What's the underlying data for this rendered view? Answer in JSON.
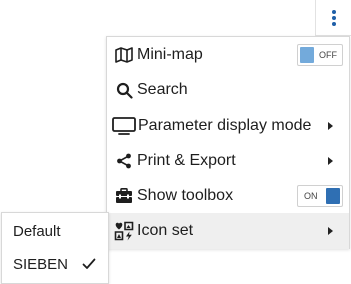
{
  "toolbar": {
    "more_icon": "kebab-vertical-icon",
    "accent_color": "#1f5fa8"
  },
  "menu": {
    "items": [
      {
        "label": "Mini-map",
        "icon": "map-icon",
        "toggle": {
          "state": "off",
          "label": "OFF"
        }
      },
      {
        "label": "Search",
        "icon": "search-icon"
      },
      {
        "label": "Parameter display mode",
        "icon": "monitor-icon",
        "has_submenu": true
      },
      {
        "label": "Print & Export",
        "icon": "share-icon",
        "has_submenu": true
      },
      {
        "label": "Show toolbox",
        "icon": "toolbox-icon",
        "toggle": {
          "state": "on",
          "label": "ON"
        }
      },
      {
        "label": "Icon set",
        "icon": "icon-set-icon",
        "has_submenu": true,
        "active": true
      }
    ]
  },
  "submenu": {
    "items": [
      {
        "label": "Default",
        "selected": false
      },
      {
        "label": "SIEBEN",
        "selected": true,
        "check_icon": "checkmark-icon"
      }
    ]
  }
}
